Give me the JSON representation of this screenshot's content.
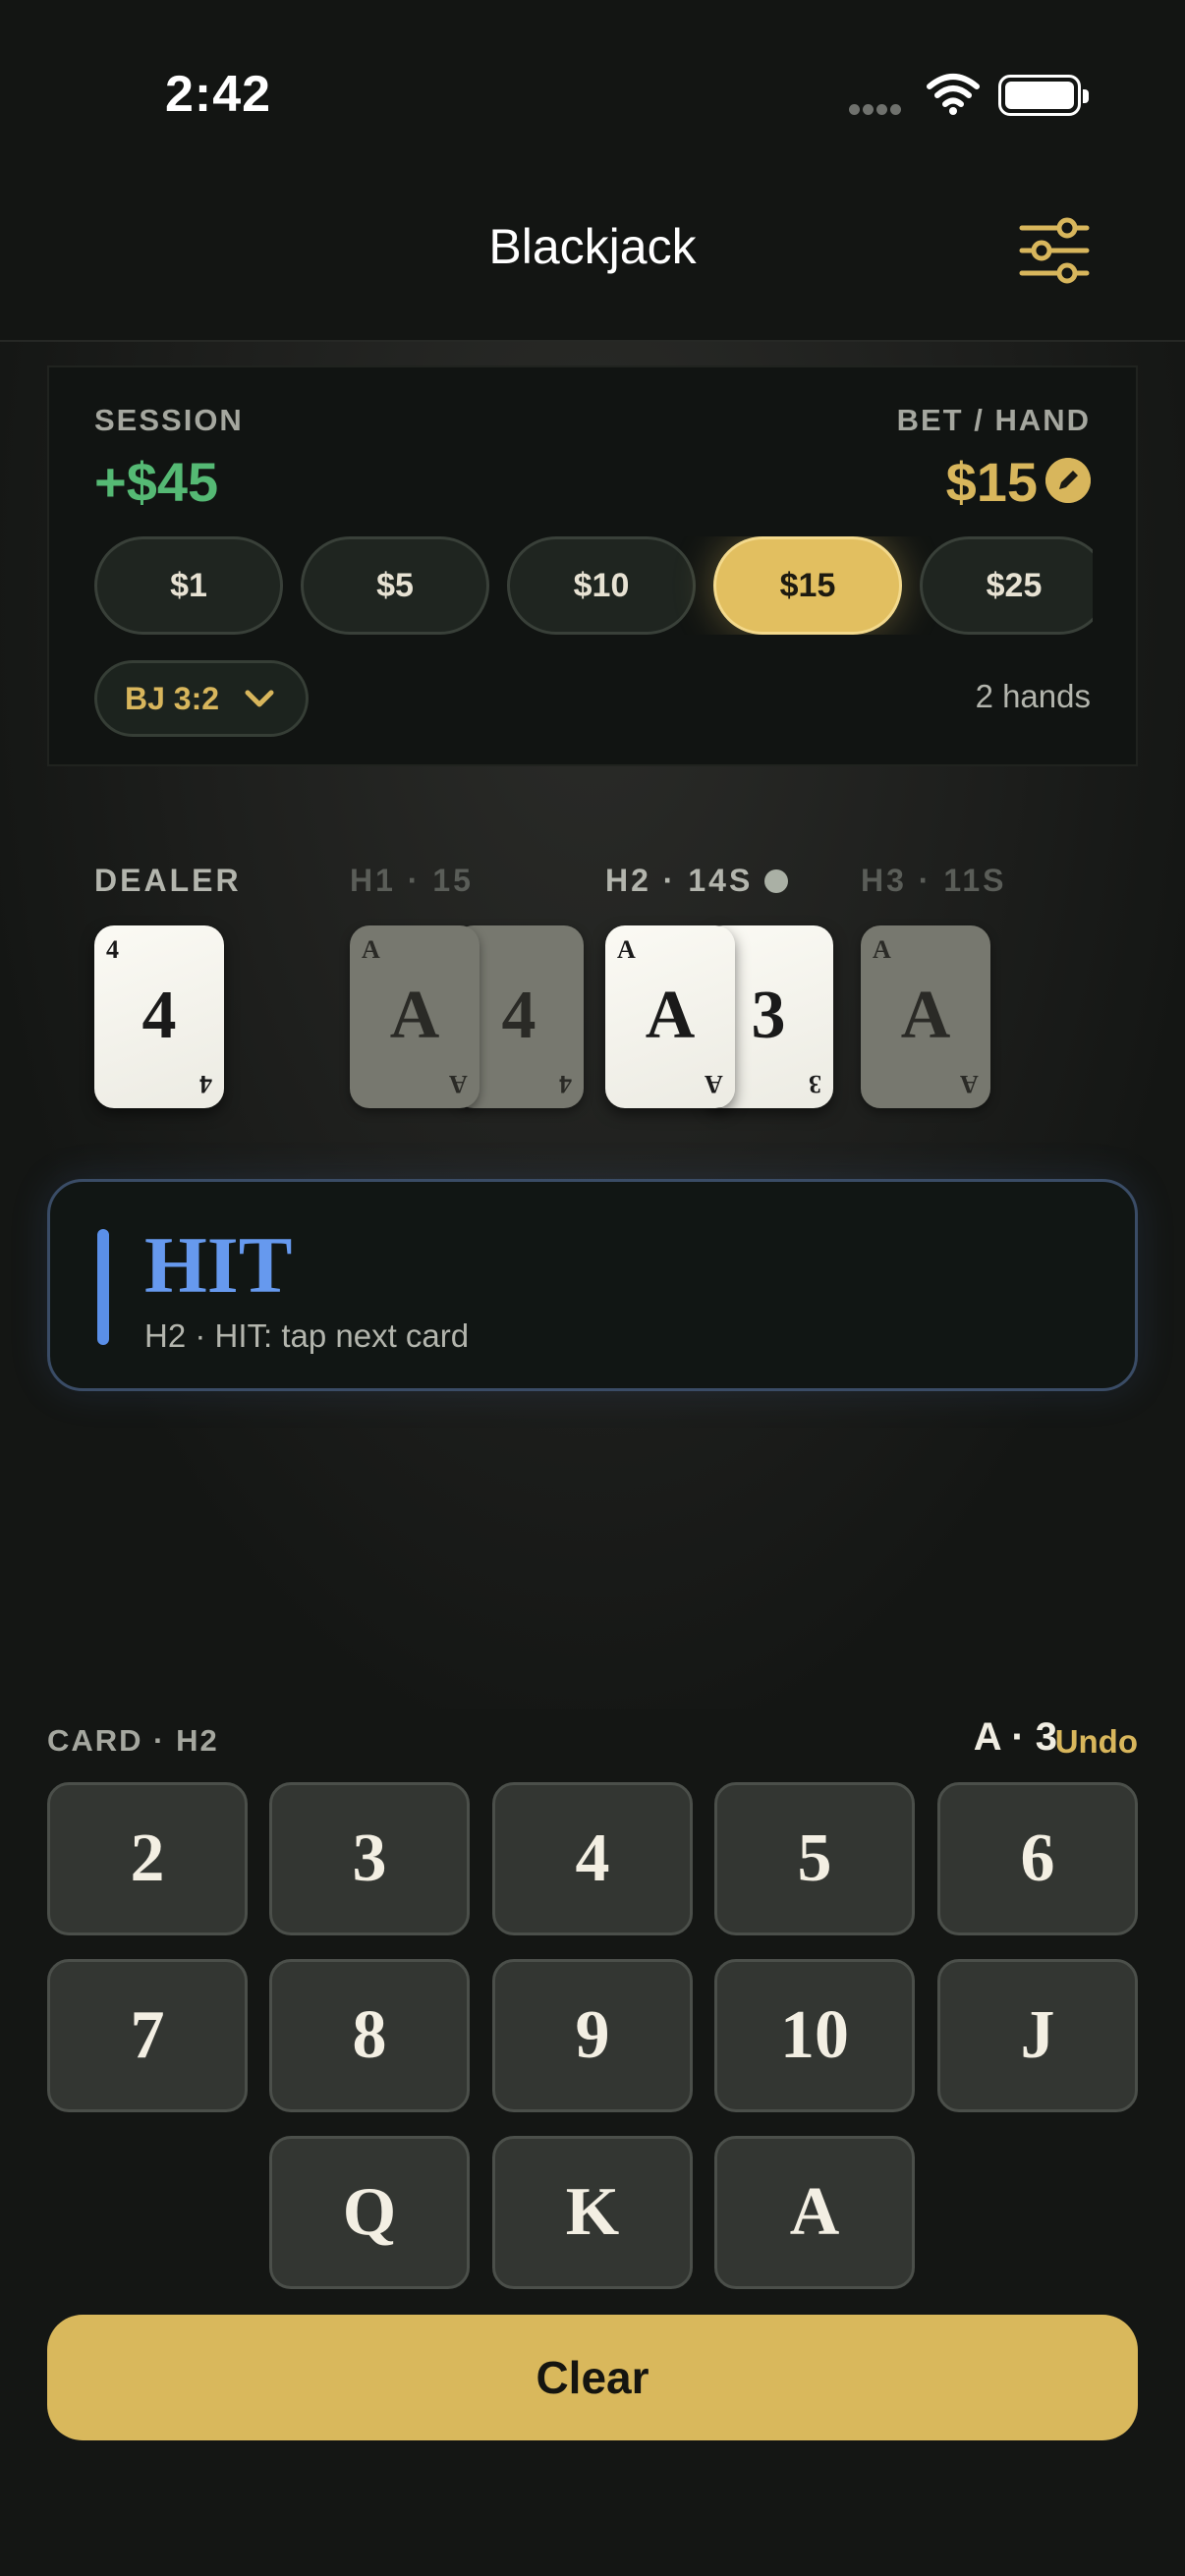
{
  "status_bar": {
    "time": "2:42"
  },
  "nav": {
    "title": "Blackjack",
    "settings_icon": "sliders-icon"
  },
  "session": {
    "label": "SESSION",
    "value": "+$45",
    "bet_label": "BET / HAND",
    "bet_value": "$15",
    "chips": [
      {
        "label": "$1",
        "selected": false
      },
      {
        "label": "$5",
        "selected": false
      },
      {
        "label": "$10",
        "selected": false
      },
      {
        "label": "$15",
        "selected": true
      },
      {
        "label": "$25",
        "selected": false
      }
    ],
    "rule": "BJ 3:2",
    "hands_count": "2 hands"
  },
  "table": {
    "dealer": {
      "label": "DEALER",
      "cards": [
        "4"
      ]
    },
    "hands": [
      {
        "label": "H1 · 15",
        "active": false,
        "cards": [
          "A",
          "4"
        ]
      },
      {
        "label": "H2 · 14S",
        "active": true,
        "cards": [
          "A",
          "3"
        ]
      },
      {
        "label": "H3 · 11S",
        "active": false,
        "cards": [
          "A"
        ]
      }
    ]
  },
  "advice": {
    "action": "HIT",
    "detail": "H2 · HIT: tap next card"
  },
  "keypad": {
    "label": "CARD · H2",
    "current": "A · 3",
    "undo": "Undo",
    "keys": [
      "2",
      "3",
      "4",
      "5",
      "6",
      "7",
      "8",
      "9",
      "10",
      "J",
      "Q",
      "K",
      "A"
    ],
    "clear": "Clear"
  },
  "colors": {
    "accent_gold": "#d8b65c",
    "positive_green": "#55b974",
    "advice_blue": "#6699ee"
  }
}
